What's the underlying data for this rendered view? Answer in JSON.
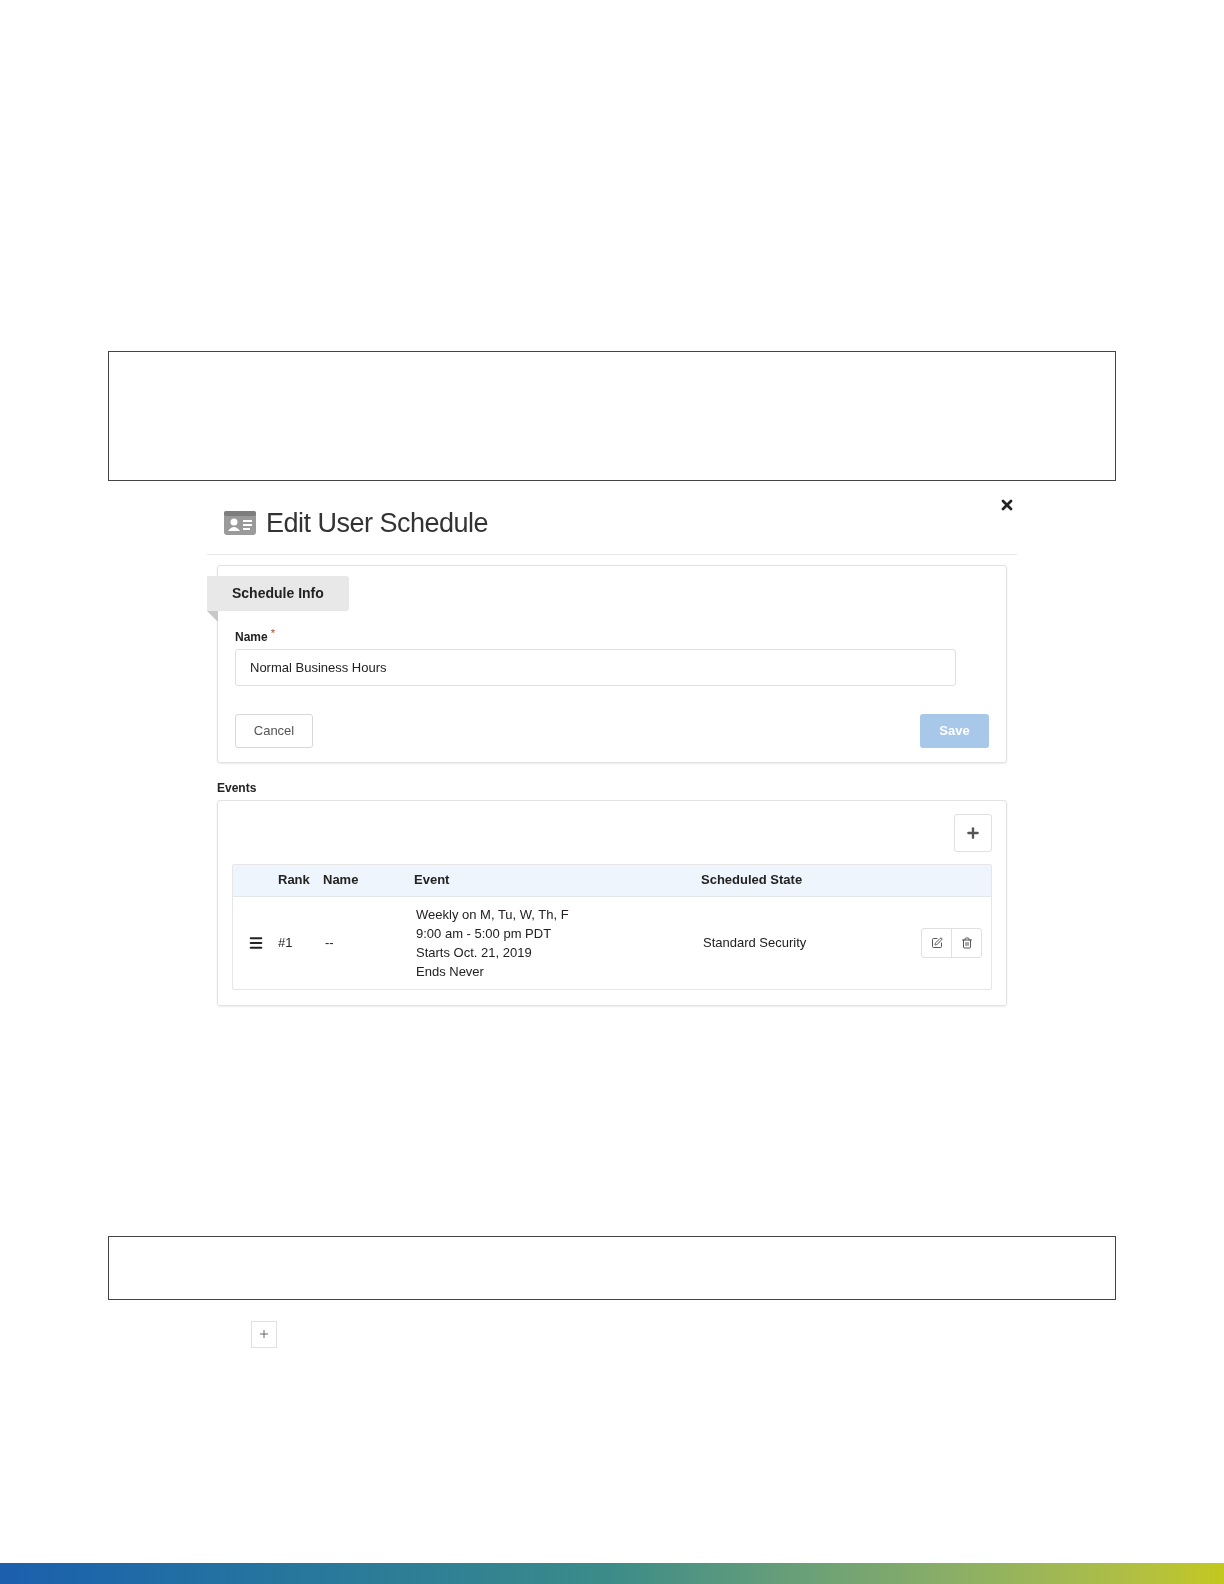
{
  "dialog": {
    "title": "Edit User Schedule"
  },
  "schedule_info": {
    "tab": "Schedule Info",
    "name_label": "Name",
    "required_mark": "*",
    "name_value": "Normal Business Hours",
    "cancel": "Cancel",
    "save": "Save",
    "save_disabled": true
  },
  "events": {
    "label": "Events",
    "columns": [
      "Rank",
      "Name",
      "Event",
      "Scheduled State"
    ],
    "rows": [
      {
        "rank": "#1",
        "name": "--",
        "event": [
          "Weekly on M, Tu, W, Th, F",
          "9:00 am - 5:00 pm PDT",
          "Starts Oct. 21, 2019",
          "Ends Never"
        ],
        "state": "Standard Security"
      }
    ]
  }
}
